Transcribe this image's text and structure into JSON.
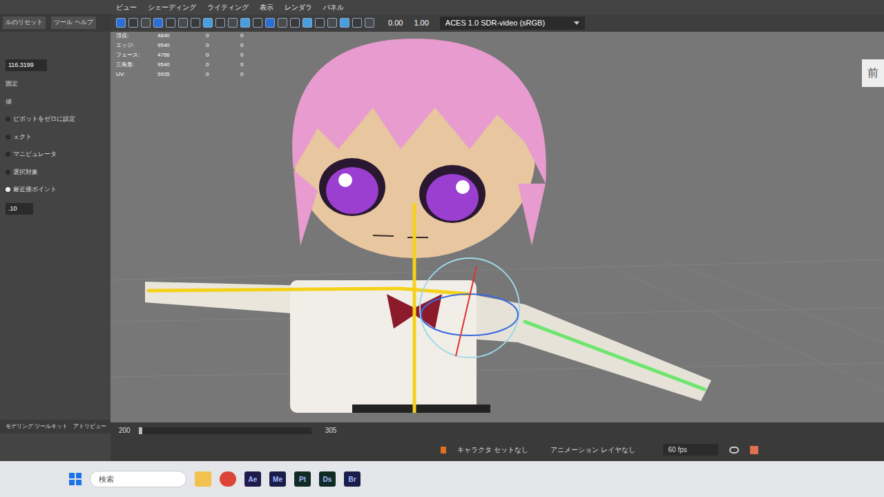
{
  "menu": [
    "ビュー",
    "シェーディング",
    "ライティング",
    "表示",
    "レンダラ",
    "パネル"
  ],
  "left_panel": {
    "tabs": [
      "ルのリセット",
      "ツール ヘルプ"
    ],
    "field": "116.3199",
    "options": [
      {
        "label": "固定",
        "kind": "text",
        "selected": false
      },
      {
        "label": "値",
        "kind": "text",
        "selected": false
      },
      {
        "label": "ピボットをゼロに設定",
        "kind": "radio",
        "selected": false
      },
      {
        "label": "ェクト",
        "kind": "radio",
        "selected": false
      },
      {
        "label": "マニピュレータ",
        "kind": "radio",
        "selected": false
      },
      {
        "label": "選択対象",
        "kind": "radio",
        "selected": false
      },
      {
        "label": "最近接ポイント",
        "kind": "radio",
        "selected": true
      }
    ],
    "value_field": ".10",
    "bottom_tabs": [
      "モデリング ツールキット",
      "アトリビュー"
    ]
  },
  "toolbar": {
    "exposure": "0.00",
    "gamma": "1.00",
    "color_space": "ACES 1.0 SDR-video (sRGB)"
  },
  "hud": [
    {
      "label": "頂点:",
      "values": [
        "4840",
        "0",
        "0"
      ]
    },
    {
      "label": "エッジ:",
      "values": [
        "9540",
        "0",
        "0"
      ]
    },
    {
      "label": "フェース:",
      "values": [
        "4766",
        "0",
        "0"
      ]
    },
    {
      "label": "三角形:",
      "values": [
        "9540",
        "0",
        "0"
      ]
    },
    {
      "label": "UV:",
      "values": [
        "5935",
        "0",
        "0"
      ]
    }
  ],
  "view_label": "前",
  "timeline": {
    "start": "200",
    "end": "305",
    "level": 0.02,
    "character_set": "キャラクタ セットなし",
    "anim_layer": "アニメーション レイヤなし",
    "fps": "60 fps"
  },
  "taskbar": {
    "search": "検索",
    "apps": [
      {
        "kind": "folder",
        "label": "",
        "color": "#f2c14e"
      },
      {
        "kind": "chrome",
        "label": "",
        "color": "#db4437"
      },
      {
        "kind": "badge",
        "label": "Ae",
        "color": "#1e1a4a"
      },
      {
        "kind": "badge",
        "label": "Me",
        "color": "#1a1d4a"
      },
      {
        "kind": "badge",
        "label": "Pt",
        "color": "#0f2b24"
      },
      {
        "kind": "badge",
        "label": "Ds",
        "color": "#0f2b24"
      },
      {
        "kind": "badge",
        "label": "Br",
        "color": "#1a1d4a"
      }
    ]
  }
}
